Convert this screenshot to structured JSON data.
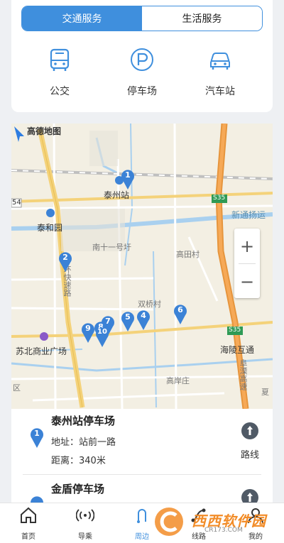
{
  "segments": {
    "active": "交通服务",
    "inactive": "生活服务"
  },
  "services": [
    {
      "label": "公交",
      "icon": "bus-icon"
    },
    {
      "label": "停车场",
      "icon": "parking-icon"
    },
    {
      "label": "汽车站",
      "icon": "car-icon"
    }
  ],
  "map": {
    "provider": "高德地图",
    "labels": {
      "taizhou_station": "泰州站",
      "taihe_yuan": "泰和园",
      "nan_shiyi": "南十一号圩",
      "gaotian": "高田村",
      "shuangqiao": "双桥村",
      "subei": "苏北商业广场",
      "hailing": "海陵互通",
      "gaoan": "高岸庄",
      "xintong": "新通扬运",
      "huanshu": "环快速路",
      "xia": "夏",
      "qu": "区",
      "left54": "54",
      "s35a": "S35",
      "s35b": "S35",
      "fu": "阜溧高速"
    },
    "pins": [
      "1",
      "2",
      "4",
      "5",
      "6",
      "7",
      "8",
      "9",
      "10"
    ]
  },
  "zoom": {
    "in": "+",
    "out": "−"
  },
  "results": [
    {
      "name": "泰州站停车场",
      "address": "地址：站前一路",
      "distance": "距离：340米",
      "route": "路线",
      "pin": "1"
    },
    {
      "name": "金盾停车场",
      "route": "路线"
    }
  ],
  "tabs": [
    {
      "label": "首页",
      "icon": "home-icon"
    },
    {
      "label": "导乘",
      "icon": "signal-icon"
    },
    {
      "label": "周边",
      "icon": "nearby-icon"
    },
    {
      "label": "线路",
      "icon": "route-icon"
    },
    {
      "label": "我的",
      "icon": "user-icon"
    }
  ],
  "watermark": {
    "text": "西西软件园",
    "url": "CR173.COM"
  },
  "colors": {
    "accent": "#3f8fdd",
    "pin": "#3b82d6",
    "highway": "#f0a04b",
    "road": "#f4d27a"
  }
}
